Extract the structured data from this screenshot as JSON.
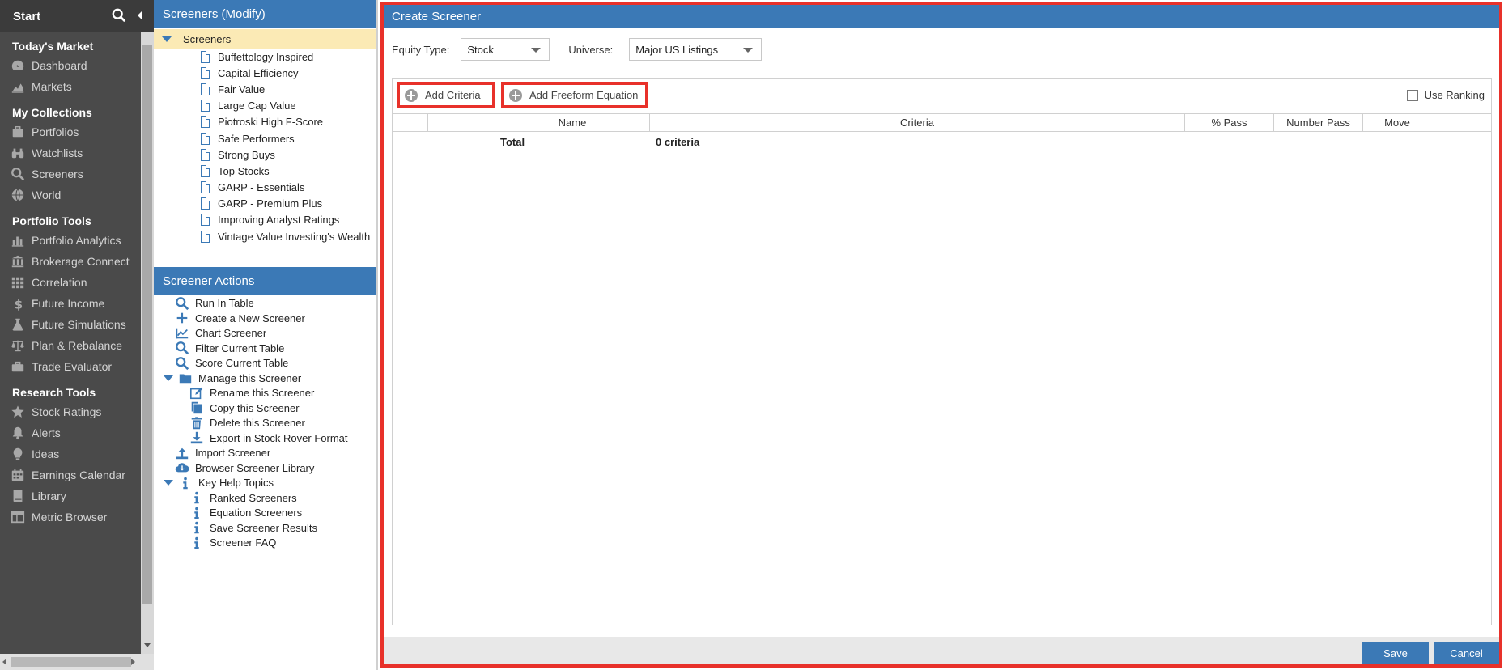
{
  "nav": {
    "title": "Start",
    "sections": [
      {
        "label": "Today's Market",
        "items": [
          {
            "label": "Dashboard",
            "icon": "dashboard-icon"
          },
          {
            "label": "Markets",
            "icon": "chart-area-icon"
          }
        ]
      },
      {
        "label": "My Collections",
        "items": [
          {
            "label": "Portfolios",
            "icon": "briefcase-stack-icon"
          },
          {
            "label": "Watchlists",
            "icon": "binoculars-icon"
          },
          {
            "label": "Screeners",
            "icon": "search-icon"
          },
          {
            "label": "World",
            "icon": "globe-icon"
          }
        ]
      },
      {
        "label": "Portfolio Tools",
        "items": [
          {
            "label": "Portfolio Analytics",
            "icon": "bar-chart-icon"
          },
          {
            "label": "Brokerage Connect",
            "icon": "bank-icon"
          },
          {
            "label": "Correlation",
            "icon": "grid-icon"
          },
          {
            "label": "Future Income",
            "icon": "dollar-icon"
          },
          {
            "label": "Future Simulations",
            "icon": "flask-icon"
          },
          {
            "label": "Plan & Rebalance",
            "icon": "scales-icon"
          },
          {
            "label": "Trade Evaluator",
            "icon": "toolbox-icon"
          }
        ]
      },
      {
        "label": "Research Tools",
        "items": [
          {
            "label": "Stock Ratings",
            "icon": "star-icon"
          },
          {
            "label": "Alerts",
            "icon": "bell-icon"
          },
          {
            "label": "Ideas",
            "icon": "lightbulb-icon"
          },
          {
            "label": "Earnings Calendar",
            "icon": "calendar-icon"
          },
          {
            "label": "Library",
            "icon": "book-icon"
          },
          {
            "label": "Metric Browser",
            "icon": "table-icon"
          }
        ]
      }
    ]
  },
  "screeners_panel": {
    "title": "Screeners (Modify)",
    "root": "Screeners",
    "items": [
      "Buffettology Inspired",
      "Capital Efficiency",
      "Fair Value",
      "Large Cap Value",
      "Piotroski High F-Score",
      "Safe Performers",
      "Strong Buys",
      "Top Stocks",
      "GARP - Essentials",
      "GARP - Premium Plus",
      "Improving Analyst Ratings",
      "Vintage Value Investing's Wealth"
    ]
  },
  "actions_panel": {
    "title": "Screener Actions",
    "items": [
      {
        "label": "Run In Table",
        "icon": "search-icon",
        "level": 1
      },
      {
        "label": "Create a New Screener",
        "icon": "plus-icon",
        "level": 1
      },
      {
        "label": "Chart Screener",
        "icon": "line-chart-icon",
        "level": 1
      },
      {
        "label": "Filter Current Table",
        "icon": "search-icon",
        "level": 1
      },
      {
        "label": "Score Current Table",
        "icon": "search-icon",
        "level": 1
      },
      {
        "label": "Manage this Screener",
        "icon": "folder-icon",
        "level": 1,
        "expanded": true
      },
      {
        "label": "Rename this Screener",
        "icon": "edit-icon",
        "level": 2
      },
      {
        "label": "Copy this Screener",
        "icon": "copy-icon",
        "level": 2
      },
      {
        "label": "Delete this Screener",
        "icon": "trash-icon",
        "level": 2
      },
      {
        "label": "Export in Stock Rover Format",
        "icon": "download-icon",
        "level": 2
      },
      {
        "label": "Import Screener",
        "icon": "upload-icon",
        "level": 1
      },
      {
        "label": "Browser Screener Library",
        "icon": "cloud-download-icon",
        "level": 1
      },
      {
        "label": "Key Help Topics",
        "icon": "info-icon",
        "level": 1,
        "expanded": true
      },
      {
        "label": "Ranked Screeners",
        "icon": "info-icon",
        "level": 2
      },
      {
        "label": "Equation Screeners",
        "icon": "info-icon",
        "level": 2
      },
      {
        "label": "Save Screener Results",
        "icon": "info-icon",
        "level": 2
      },
      {
        "label": "Screener FAQ",
        "icon": "info-icon",
        "level": 2
      }
    ]
  },
  "create": {
    "title": "Create Screener",
    "equity_type_label": "Equity Type:",
    "equity_type_value": "Stock",
    "universe_label": "Universe:",
    "universe_value": "Major US Listings",
    "add_criteria": "Add Criteria",
    "add_freeform": "Add Freeform Equation",
    "use_ranking": "Use Ranking",
    "columns": [
      "",
      "",
      "Name",
      "Criteria",
      "% Pass",
      "Number Pass",
      "Move"
    ],
    "total_label": "Total",
    "total_value": "0 criteria",
    "save": "Save",
    "cancel": "Cancel"
  },
  "colors": {
    "accent": "#3b79b6",
    "highlight_border": "#e8312a",
    "nav_bg": "#4a4a4a",
    "selected_row": "#fbeab5"
  }
}
